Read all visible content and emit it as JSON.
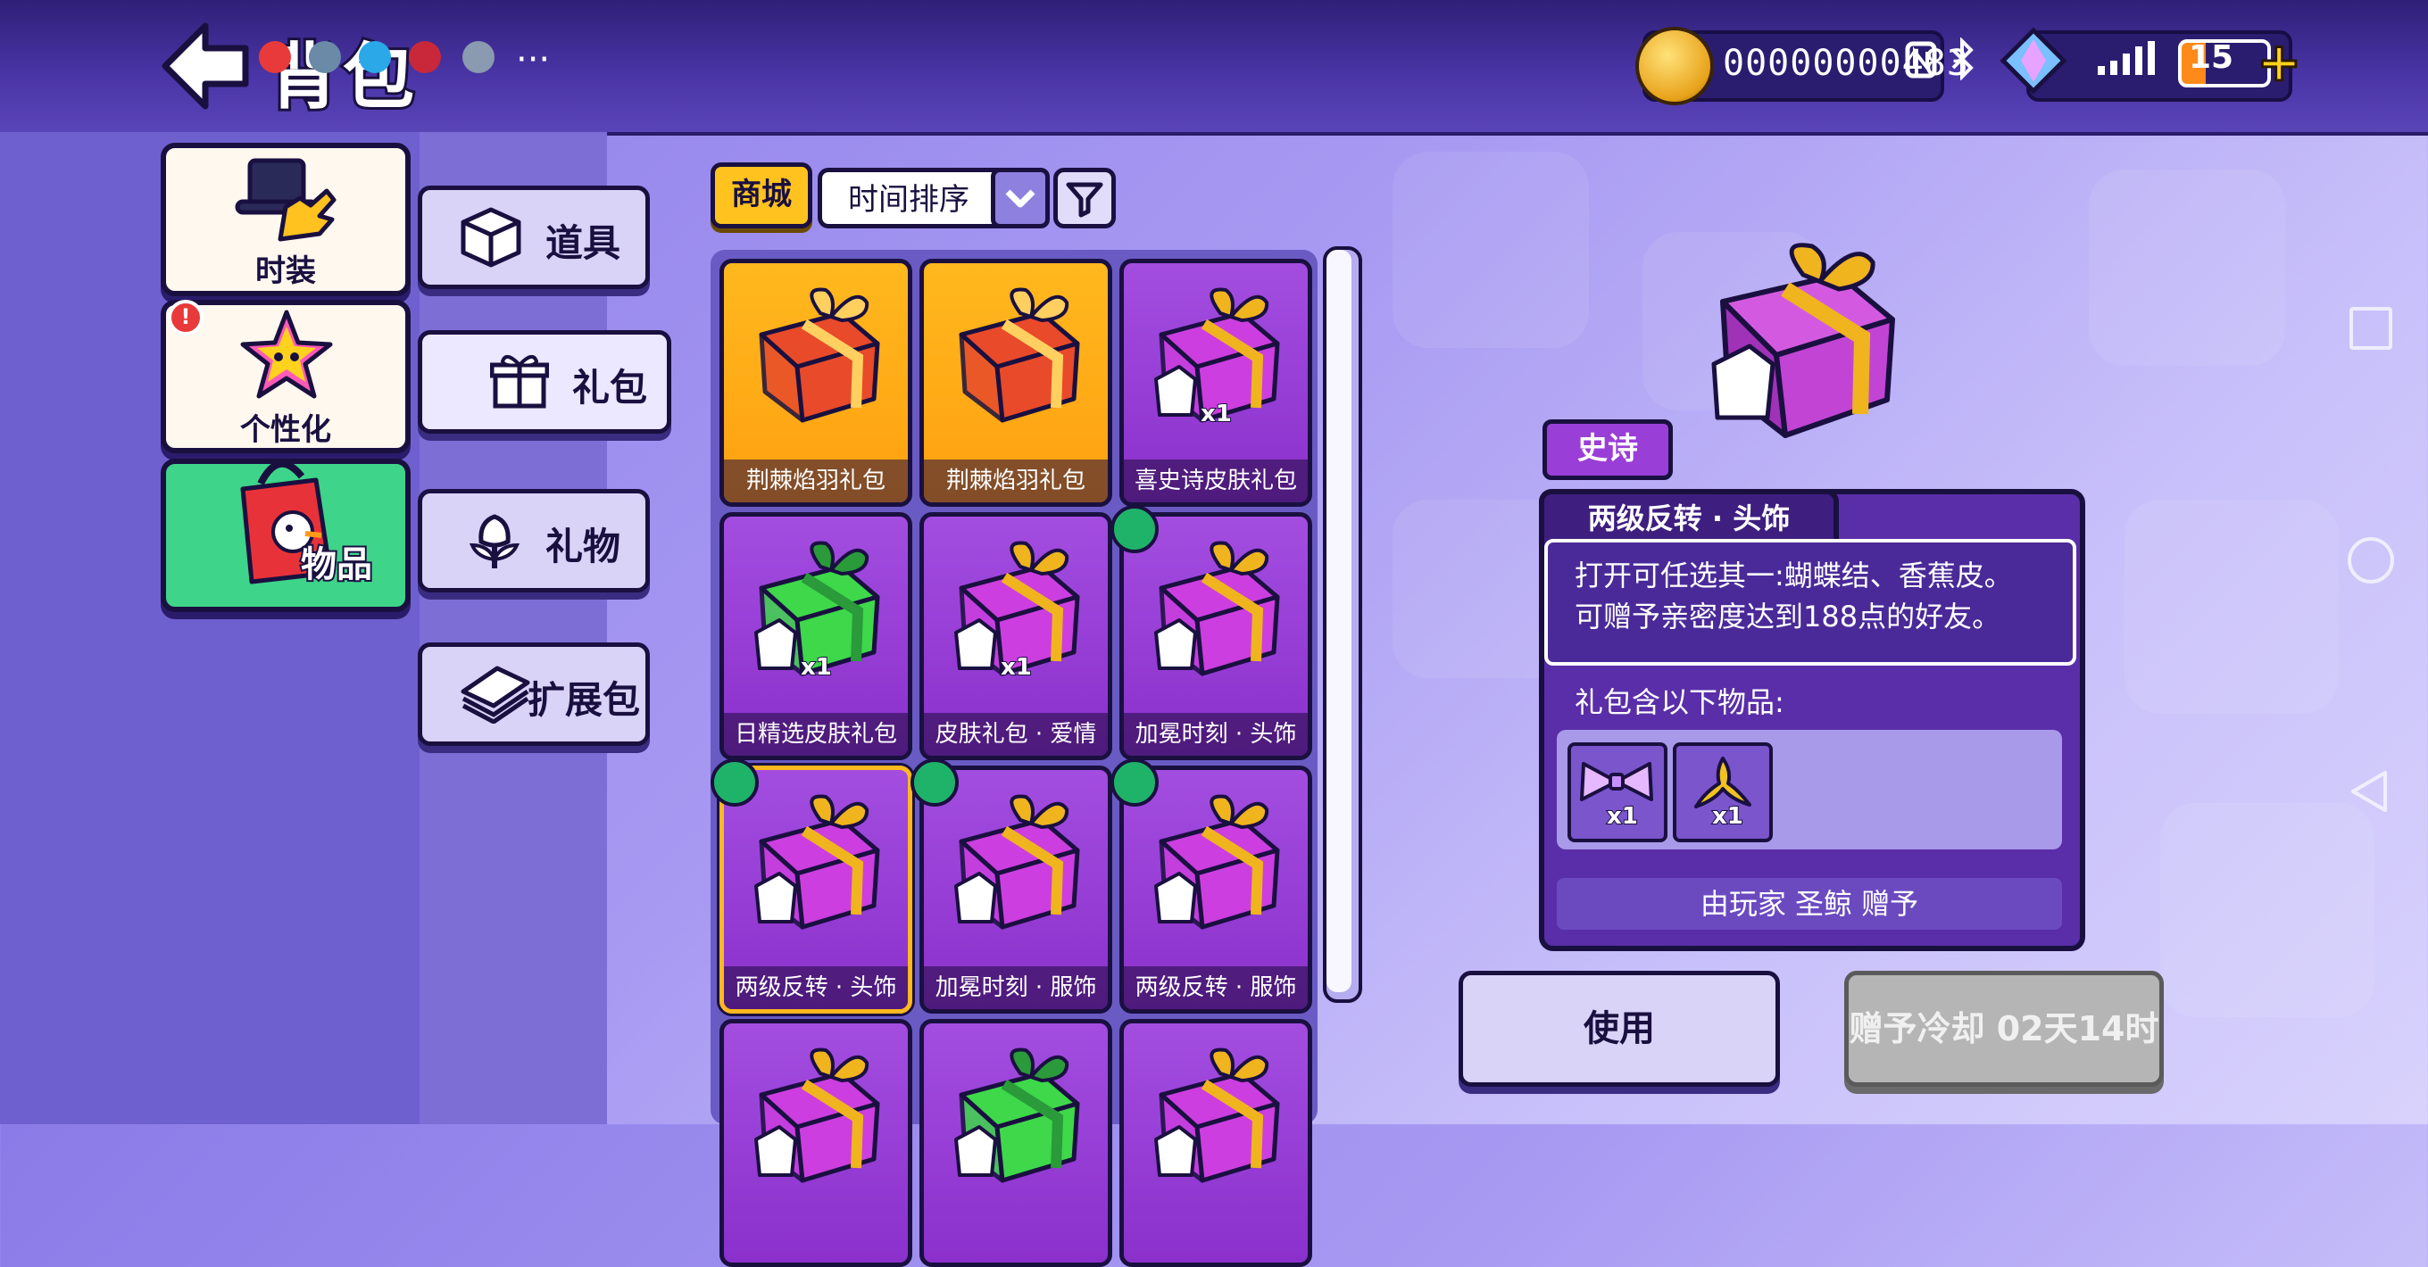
{
  "header": {
    "title": "背包",
    "coins": "00000000483",
    "battery": "15",
    "more": "···"
  },
  "categories": [
    {
      "label": "时装",
      "icon": "top-hat-glove-icon"
    },
    {
      "label": "个性化",
      "icon": "star-face-icon"
    },
    {
      "label": "物品",
      "icon": "bag-icon"
    }
  ],
  "sub_tabs": [
    {
      "label": "道具",
      "icon": "cube-icon"
    },
    {
      "label": "礼包",
      "icon": "gift-icon"
    },
    {
      "label": "礼物",
      "icon": "flower-icon"
    },
    {
      "label": "扩展包",
      "icon": "cards-icon"
    }
  ],
  "toolbar": {
    "shop": "商城",
    "sort": "时间排序"
  },
  "items": [
    {
      "name": "荆棘焰羽礼包",
      "style": "gold",
      "qty": ""
    },
    {
      "name": "荆棘焰羽礼包",
      "style": "gold",
      "qty": ""
    },
    {
      "name": "喜史诗皮肤礼包",
      "style": "purple",
      "qty": "x1"
    },
    {
      "name": "日精选皮肤礼包",
      "style": "purple",
      "qty": "x1"
    },
    {
      "name": "皮肤礼包 · 爱情",
      "style": "purple",
      "qty": "x1"
    },
    {
      "name": "加冕时刻 · 头饰",
      "style": "purple",
      "qty": ""
    },
    {
      "name": "两级反转 · 头饰",
      "style": "purple",
      "qty": ""
    },
    {
      "name": "加冕时刻 · 服饰",
      "style": "purple",
      "qty": ""
    },
    {
      "name": "两级反转 · 服饰",
      "style": "purple",
      "qty": ""
    },
    {
      "name": "",
      "style": "purple",
      "qty": ""
    },
    {
      "name": "",
      "style": "purple",
      "qty": ""
    },
    {
      "name": "",
      "style": "purple",
      "qty": ""
    }
  ],
  "detail": {
    "rarity": "史诗",
    "name": "两级反转 · 头饰",
    "desc_line1": "打开可任选其一:蝴蝶结、香蕉皮。",
    "desc_line2": "可赠予亲密度达到188点的好友。",
    "contents_label": "礼包含以下物品:",
    "contents": [
      {
        "icon": "bow-icon",
        "qty": "x1"
      },
      {
        "icon": "banana-peel-icon",
        "qty": "x1"
      }
    ],
    "giver": "由玩家 圣鲸 赠予",
    "use_label": "使用",
    "gift_label": "赠予冷却 02天14时"
  }
}
